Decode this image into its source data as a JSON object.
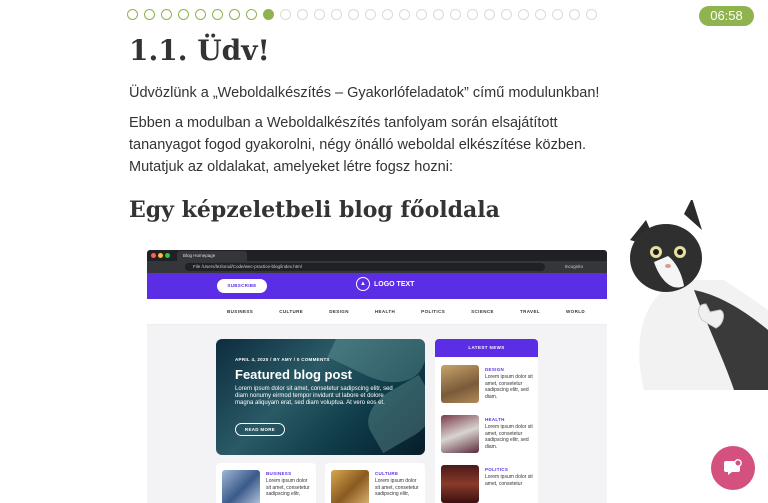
{
  "progress": {
    "total_steps": 28,
    "completed_steps": 8,
    "current_step": 9
  },
  "timer": "06:58",
  "lesson": {
    "title": "1.1. Üdv!",
    "intro": "Üdvözlünk a „Weboldalkészítés – Gyakorlófeladatok” című modulunkban!",
    "paragraph": "Ebben a modulban a Weboldalkészítés tanfolyam során elsajátított tananyagot fogod gyakorolni, négy önálló weboldal elkészítése közben. Mutatjuk az oldalakat, amelyeket létre fogsz hozni:",
    "section_title": "Egy képzeletbeli blog főoldala"
  },
  "screenshot": {
    "tab_title": "Blog Homepage",
    "url": "File  /Users/lezlorod/Code/wec-practice-blog/index.html",
    "incognito": "Incognito",
    "subscribe": "SUBSCRIBE",
    "logo_text": "LOGO TEXT",
    "nav": [
      "BUSINESS",
      "CULTURE",
      "DESIGN",
      "HEALTH",
      "POLITICS",
      "SCIENCE",
      "TRAVEL",
      "WORLD"
    ],
    "featured": {
      "meta": "APRIL 4, 2020 / BY AMY / 0 COMMENTS",
      "title": "Featured blog post",
      "text": "Lorem ipsum dolor sit amet, consetetur sadipscing elitr, sed diam nonumy eirmod tempor invidunt ut labore et dolore magna aliquyam erat, sed diam voluptua. At vero eos et.",
      "button": "READ MORE"
    },
    "latest_news": {
      "heading": "LATEST NEWS",
      "items": [
        {
          "category": "DESIGN",
          "text": "Lorem ipsum dolor sit amet, consetetur sadipscing elitr, sed diam."
        },
        {
          "category": "HEALTH",
          "text": "Lorem ipsum dolor sit amet, consetetur sadipscing elitr, sed diam."
        },
        {
          "category": "POLITICS",
          "text": "Lorem ipsum dolor sit amet, consetetur"
        }
      ]
    },
    "cards": [
      {
        "category": "BUSINESS",
        "text": "Lorem ipsum dolor sit amet, consetetur sadipscing elitr,"
      },
      {
        "category": "CULTURE",
        "text": "Lorem ipsum dolor sit amet, consetetur sadipscing elitr,"
      }
    ]
  },
  "chat": {
    "icon": "chat-bubble-icon"
  },
  "colors": {
    "accent": "#8fb34f",
    "brand_purple": "#5b2ee6",
    "chat": "#d4507f"
  }
}
